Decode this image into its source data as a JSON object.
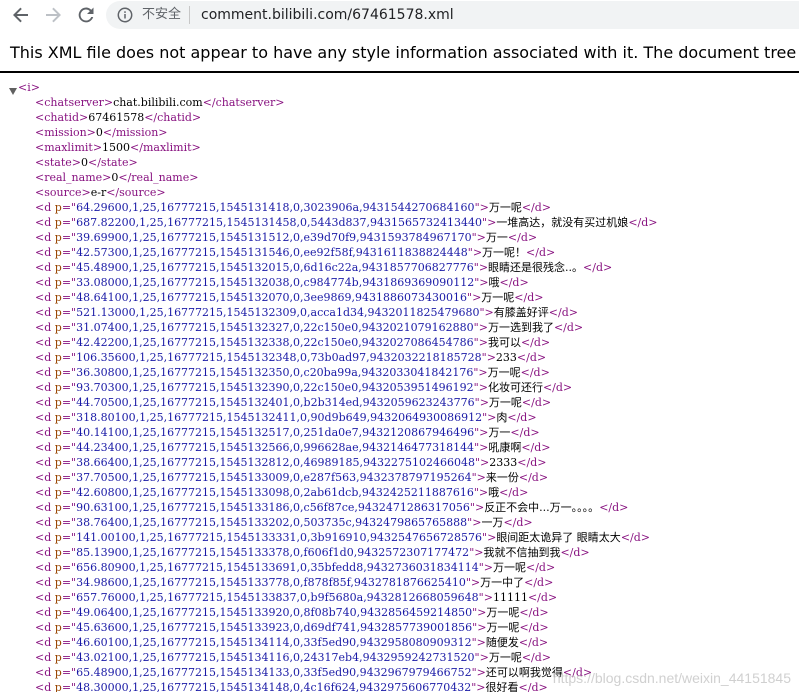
{
  "browser": {
    "security_label": "不安全",
    "url": "comment.bilibili.com/67461578.xml"
  },
  "xml_banner": "This XML file does not appear to have any style information associated with it. The document tree is shown below.",
  "root_tag": "<i>",
  "header_fields": [
    {
      "tag": "chatserver",
      "value": "chat.bilibili.com"
    },
    {
      "tag": "chatid",
      "value": "67461578"
    },
    {
      "tag": "mission",
      "value": "0"
    },
    {
      "tag": "maxlimit",
      "value": "1500"
    },
    {
      "tag": "state",
      "value": "0"
    },
    {
      "tag": "real_name",
      "value": "0"
    },
    {
      "tag": "source",
      "value": "e-r"
    }
  ],
  "danmaku": [
    {
      "p": "64.29600,1,25,16777215,1545131418,0,3023906a,9431544270684160",
      "text": "万一呢"
    },
    {
      "p": "687.82200,1,25,16777215,1545131458,0,5443d837,9431565732413440",
      "text": "一堆高达，就没有买过机娘"
    },
    {
      "p": "39.69900,1,25,16777215,1545131512,0,e39d70f9,9431593784967170",
      "text": "万一"
    },
    {
      "p": "42.57300,1,25,16777215,1545131546,0,ee92f58f,9431611838824448",
      "text": "万一呢！"
    },
    {
      "p": "45.48900,1,25,16777215,1545132015,0,6d16c22a,9431857706827776",
      "text": "眼睛还是很残念..。"
    },
    {
      "p": "33.08000,1,25,16777215,1545132038,0,c984774b,9431869369090112",
      "text": "哦"
    },
    {
      "p": "48.64100,1,25,16777215,1545132070,0,3ee9869,9431886073430016",
      "text": "万一呢"
    },
    {
      "p": "521.13000,1,25,16777215,1545132309,0,acca1d34,9432011825479680",
      "text": "有膝盖好评"
    },
    {
      "p": "31.07400,1,25,16777215,1545132327,0,22c150e0,9432021079162880",
      "text": "万一选到我了"
    },
    {
      "p": "42.42200,1,25,16777215,1545132338,0,22c150e0,9432027086454786",
      "text": "我可以"
    },
    {
      "p": "106.35600,1,25,16777215,1545132348,0,73b0ad97,9432032218185728",
      "text": "233"
    },
    {
      "p": "36.30800,1,25,16777215,1545132350,0,c20ba99a,9432033041842176",
      "text": "万一呢"
    },
    {
      "p": "93.70300,1,25,16777215,1545132390,0,22c150e0,9432053951496192",
      "text": "化妆可还行"
    },
    {
      "p": "44.70500,1,25,16777215,1545132401,0,b2b314ed,9432059623243776",
      "text": "万一呢"
    },
    {
      "p": "318.80100,1,25,16777215,1545132411,0,90d9b649,9432064930086912",
      "text": "肉"
    },
    {
      "p": "40.14100,1,25,16777215,1545132517,0,251da0e7,9432120867946496",
      "text": "万一"
    },
    {
      "p": "44.23400,1,25,16777215,1545132566,0,996628ae,9432146477318144",
      "text": "吼康啊"
    },
    {
      "p": "38.66400,1,25,16777215,1545132812,0,46989185,9432275102466048",
      "text": "2333"
    },
    {
      "p": "37.70500,1,25,16777215,1545133009,0,e287f563,9432378797195264",
      "text": "来一份"
    },
    {
      "p": "42.60800,1,25,16777215,1545133098,0,2ab61dcb,9432425211887616",
      "text": "哦"
    },
    {
      "p": "90.63100,1,25,16777215,1545133186,0,c56f87ce,9432471286317056",
      "text": "反正不会中...万一。。。。"
    },
    {
      "p": "38.76400,1,25,16777215,1545133202,0,503735c,9432479865765888",
      "text": "一万"
    },
    {
      "p": "141.00100,1,25,16777215,1545133331,0,3b916910,9432547656728576",
      "text": "眼间距太诡异了 眼睛太大"
    },
    {
      "p": "85.13900,1,25,16777215,1545133378,0,f606f1d0,9432572307177472",
      "text": "我就不信抽到我"
    },
    {
      "p": "656.80900,1,25,16777215,1545133691,0,35bfedd8,9432736031834114",
      "text": "万一呢"
    },
    {
      "p": "34.98600,1,25,16777215,1545133778,0,f878f85f,9432781876625410",
      "text": "万一中了"
    },
    {
      "p": "657.76000,1,25,16777215,1545133837,0,b9f5680a,9432812668059648",
      "text": "11111"
    },
    {
      "p": "49.06400,1,25,16777215,1545133920,0,8f08b740,9432856459214850",
      "text": "万一呢"
    },
    {
      "p": "45.63600,1,25,16777215,1545133923,0,d69df741,9432857739001856",
      "text": "万一呢"
    },
    {
      "p": "46.60100,1,25,16777215,1545134114,0,33f5ed90,9432958080909312",
      "text": "随便发"
    },
    {
      "p": "43.02100,1,25,16777215,1545134116,0,24317eb4,9432959242731520",
      "text": "万一呢"
    },
    {
      "p": "65.48900,1,25,16777215,1545134133,0,33f5ed90,9432967979466752",
      "text": "还可以啊我觉得"
    },
    {
      "p": "48.30000,1,25,16777215,1545134148,0,4c16f624,9432975606770432",
      "text": "很好看"
    }
  ],
  "watermark": "https://blog.csdn.net/weixin_44151845",
  "colors": {
    "tag": "#881280",
    "attr_name": "#994500",
    "attr_value": "#1a1aa6"
  }
}
